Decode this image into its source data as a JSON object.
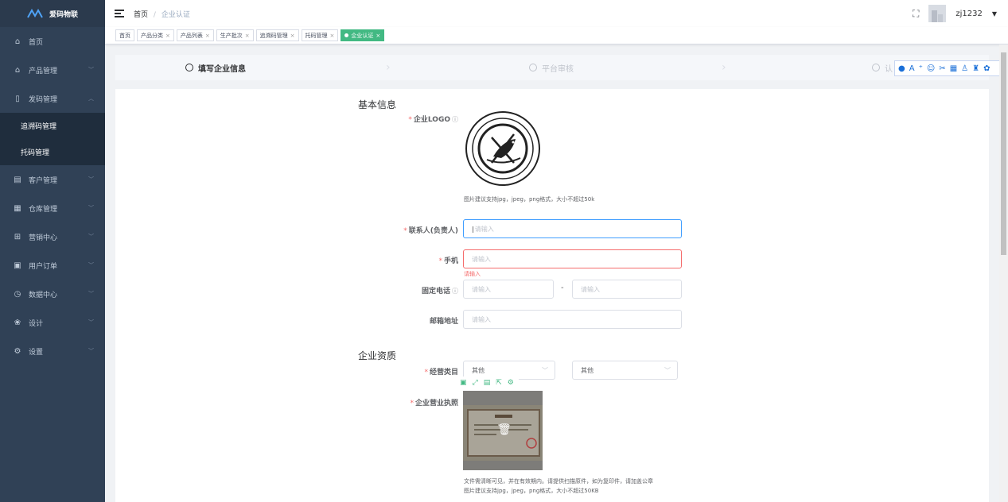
{
  "brand": {
    "name": "爱码物联"
  },
  "sidebar": {
    "items": [
      {
        "label": "首页",
        "icon": "home-icon"
      },
      {
        "label": "产品管理",
        "icon": "building-icon"
      },
      {
        "label": "发码管理",
        "icon": "mobile-icon",
        "expanded": true,
        "children": [
          {
            "label": "追溯码管理"
          },
          {
            "label": "托码管理"
          }
        ]
      },
      {
        "label": "客户管理",
        "icon": "table-icon"
      },
      {
        "label": "仓库管理",
        "icon": "grid-icon"
      },
      {
        "label": "营销中心",
        "icon": "gift-icon"
      },
      {
        "label": "用户订单",
        "icon": "doc-icon"
      },
      {
        "label": "数据中心",
        "icon": "clock-icon"
      },
      {
        "label": "设计",
        "icon": "flower-icon"
      },
      {
        "label": "设置",
        "icon": "gear-icon"
      }
    ]
  },
  "header": {
    "breadcrumb": [
      "首页",
      "企业认证"
    ],
    "breadcrumb_sep": "/",
    "username": "zj1232"
  },
  "tags": [
    {
      "label": "首页",
      "closable": false,
      "active": false
    },
    {
      "label": "产品分类",
      "closable": true,
      "active": false
    },
    {
      "label": "产品列表",
      "closable": true,
      "active": false
    },
    {
      "label": "生产批次",
      "closable": true,
      "active": false
    },
    {
      "label": "追溯码管理",
      "closable": true,
      "active": false
    },
    {
      "label": "托码管理",
      "closable": true,
      "active": false
    },
    {
      "label": "企业认证",
      "closable": true,
      "active": true
    }
  ],
  "steps": [
    {
      "label": "填写企业信息",
      "active": true
    },
    {
      "label": "平台审核",
      "active": false
    },
    {
      "label": "认",
      "active": false
    }
  ],
  "form": {
    "basic_title": "基本信息",
    "logo_label": "企业LOGO",
    "logo_hint": "图片建议支持jpg，jpeg，png格式，大小不超过50k",
    "contact_label": "联系人(负责人)",
    "contact_placeholder": "请输入",
    "phone_label": "手机",
    "phone_placeholder": "请输入",
    "phone_error": "请输入",
    "tel_label": "固定电话",
    "tel_placeholder_1": "请输入",
    "tel_dash": "-",
    "tel_placeholder_2": "请输入",
    "email_label": "邮箱地址",
    "email_placeholder": "请输入",
    "qual_title": "企业资质",
    "biz_type_label": "经营类目",
    "biz_type_value_1": "其他",
    "biz_type_value_2": "其他",
    "license_label": "企业营业执照",
    "license_hint_1": "文件需清晰可见，并在有效期内。请提供扫描原件，如为复印件，请加盖公章",
    "license_hint_2": "图片建议支持jpg，jpeg，png格式，大小不超过50KB"
  },
  "colors": {
    "sidebar": "#304156",
    "accent": "#42b983",
    "primary": "#409eff",
    "danger": "#f56c6c"
  }
}
